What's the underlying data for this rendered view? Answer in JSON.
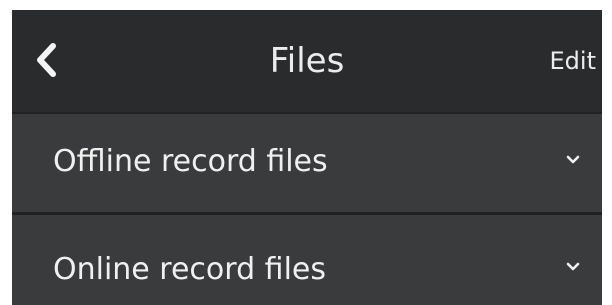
{
  "header": {
    "back_icon": "chevron-left-icon",
    "title": "Files",
    "edit_label": "Edit"
  },
  "list": {
    "items": [
      {
        "label": "Offline record files",
        "icon": "chevron-down-icon"
      },
      {
        "label": "Online record files",
        "icon": "chevron-down-icon"
      }
    ]
  },
  "colors": {
    "header_bg": "#2a2b2d",
    "list_bg": "#3a3b3d",
    "divider": "#202123",
    "text": "#f0f0f0"
  }
}
